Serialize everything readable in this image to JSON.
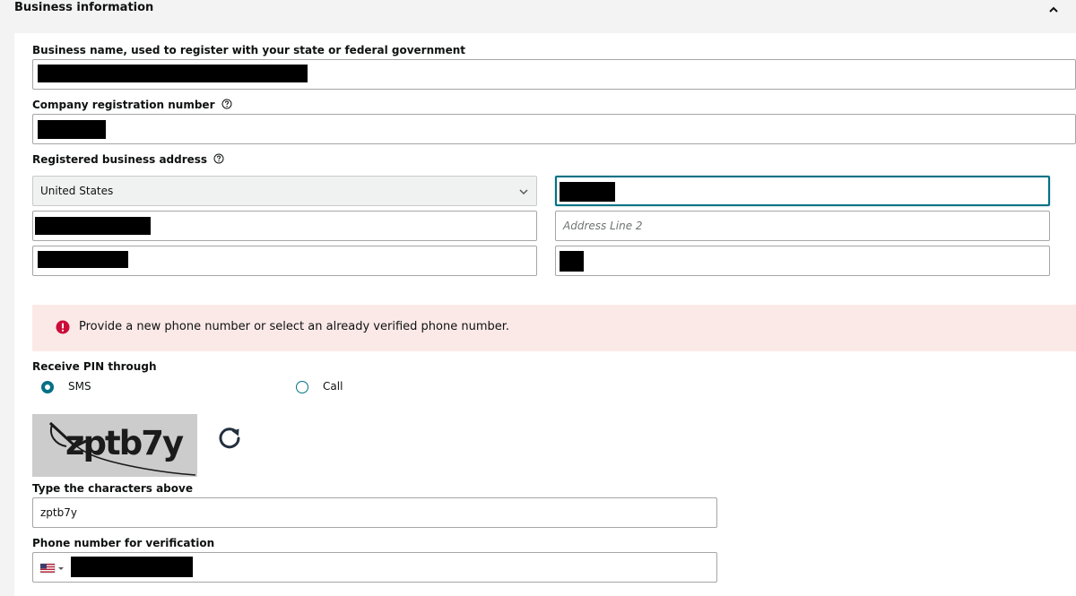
{
  "section": {
    "title": "Business information",
    "collapse_icon": "chevron-up-icon"
  },
  "business_name": {
    "label": "Business name, used to register with your state or federal government"
  },
  "registration": {
    "label": "Company registration number",
    "help_icon": "question-circle-icon"
  },
  "address": {
    "label": "Registered business address",
    "help_icon": "question-circle-icon",
    "country_value": "United States",
    "line2_placeholder": "Address Line 2"
  },
  "alert": {
    "icon": "error-icon",
    "message": "Provide a new phone number or select an already verified phone number.",
    "background": "#fbe9e8",
    "icon_color": "#cc0c39"
  },
  "pin": {
    "label": "Receive PIN through",
    "options": [
      {
        "label": "SMS",
        "selected": true
      },
      {
        "label": "Call",
        "selected": false
      }
    ]
  },
  "captcha": {
    "text": "zptb7y",
    "refresh_icon": "refresh-icon"
  },
  "captcha_input": {
    "label": "Type the characters above",
    "value": "zptb7y"
  },
  "phone": {
    "label": "Phone number for verification",
    "flag_icon": "us-flag-icon"
  },
  "colors": {
    "accent": "#007185",
    "redaction": "#000000"
  }
}
